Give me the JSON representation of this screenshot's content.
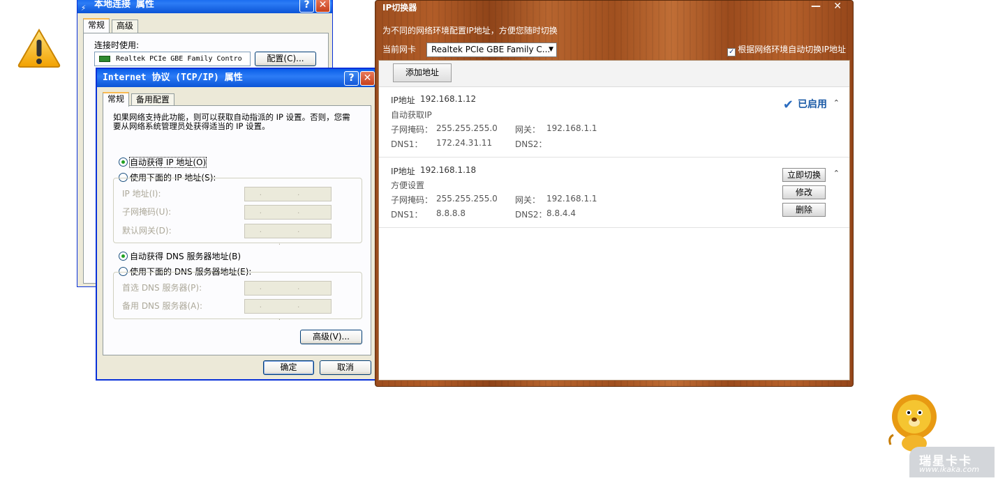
{
  "background": {
    "warning_icon": "warning-triangle-icon",
    "brand": {
      "name": "瑞星卡卡",
      "url": "www.ikaka.com"
    }
  },
  "local_conn": {
    "title": "本地连接 属性",
    "tabs": [
      "常规",
      "高级"
    ],
    "connect_using_label": "连接时使用:",
    "adapter": "Realtek PCIe GBE Family Contro",
    "configure_button": "配置(C)..."
  },
  "tcpip": {
    "title": "Internet 协议 (TCP/IP) 属性",
    "tabs": [
      "常规",
      "备用配置"
    ],
    "intro": "如果网络支持此功能，则可以获取自动指派的 IP 设置。否则，您需要从网络系统管理员处获得适当的 IP 设置。",
    "auto_ip": "自动获得 IP 地址(O)",
    "manual_ip": "使用下面的 IP 地址(S):",
    "ip_label": "IP 地址(I):",
    "mask_label": "子网掩码(U):",
    "gateway_label": "默认网关(D):",
    "auto_dns": "自动获得 DNS 服务器地址(B)",
    "manual_dns": "使用下面的 DNS 服务器地址(E):",
    "pref_dns_label": "首选 DNS 服务器(P):",
    "alt_dns_label": "备用 DNS 服务器(A):",
    "ip_placeholder": ". . .",
    "advanced_button": "高级(V)...",
    "ok_button": "确定",
    "cancel_button": "取消",
    "auto_ip_selected": true,
    "auto_dns_selected": true
  },
  "switcher": {
    "title": "IP切换器",
    "subtitle": "为不同的网络环境配置IP地址，方便您随时切换",
    "nic_label": "当前网卡",
    "nic_value": "Realtek PCIe GBE Family C...",
    "auto_switch_label": "根据网络环境自动切换IP地址",
    "auto_switch_checked": true,
    "add_button": "添加地址",
    "entries": [
      {
        "ip_label": "IP地址",
        "ip": "192.168.1.12",
        "name": "自动获取IP",
        "mask_label": "子网掩码：",
        "mask": "255.255.255.0",
        "gw_label": "网关：",
        "gw": "192.168.1.1",
        "dns1_label": "DNS1：",
        "dns1": "172.24.31.11",
        "dns2_label": "DNS2：",
        "dns2": "",
        "status": "已启用"
      },
      {
        "ip_label": "IP地址",
        "ip": "192.168.1.18",
        "name": "方便设置",
        "mask_label": "子网掩码：",
        "mask": "255.255.255.0",
        "gw_label": "网关：",
        "gw": "192.168.1.1",
        "dns1_label": "DNS1：",
        "dns1": "8.8.8.8",
        "dns2_label": "DNS2：",
        "dns2": "8.8.4.4",
        "actions": [
          "立即切换",
          "修改",
          "删除"
        ]
      }
    ]
  }
}
